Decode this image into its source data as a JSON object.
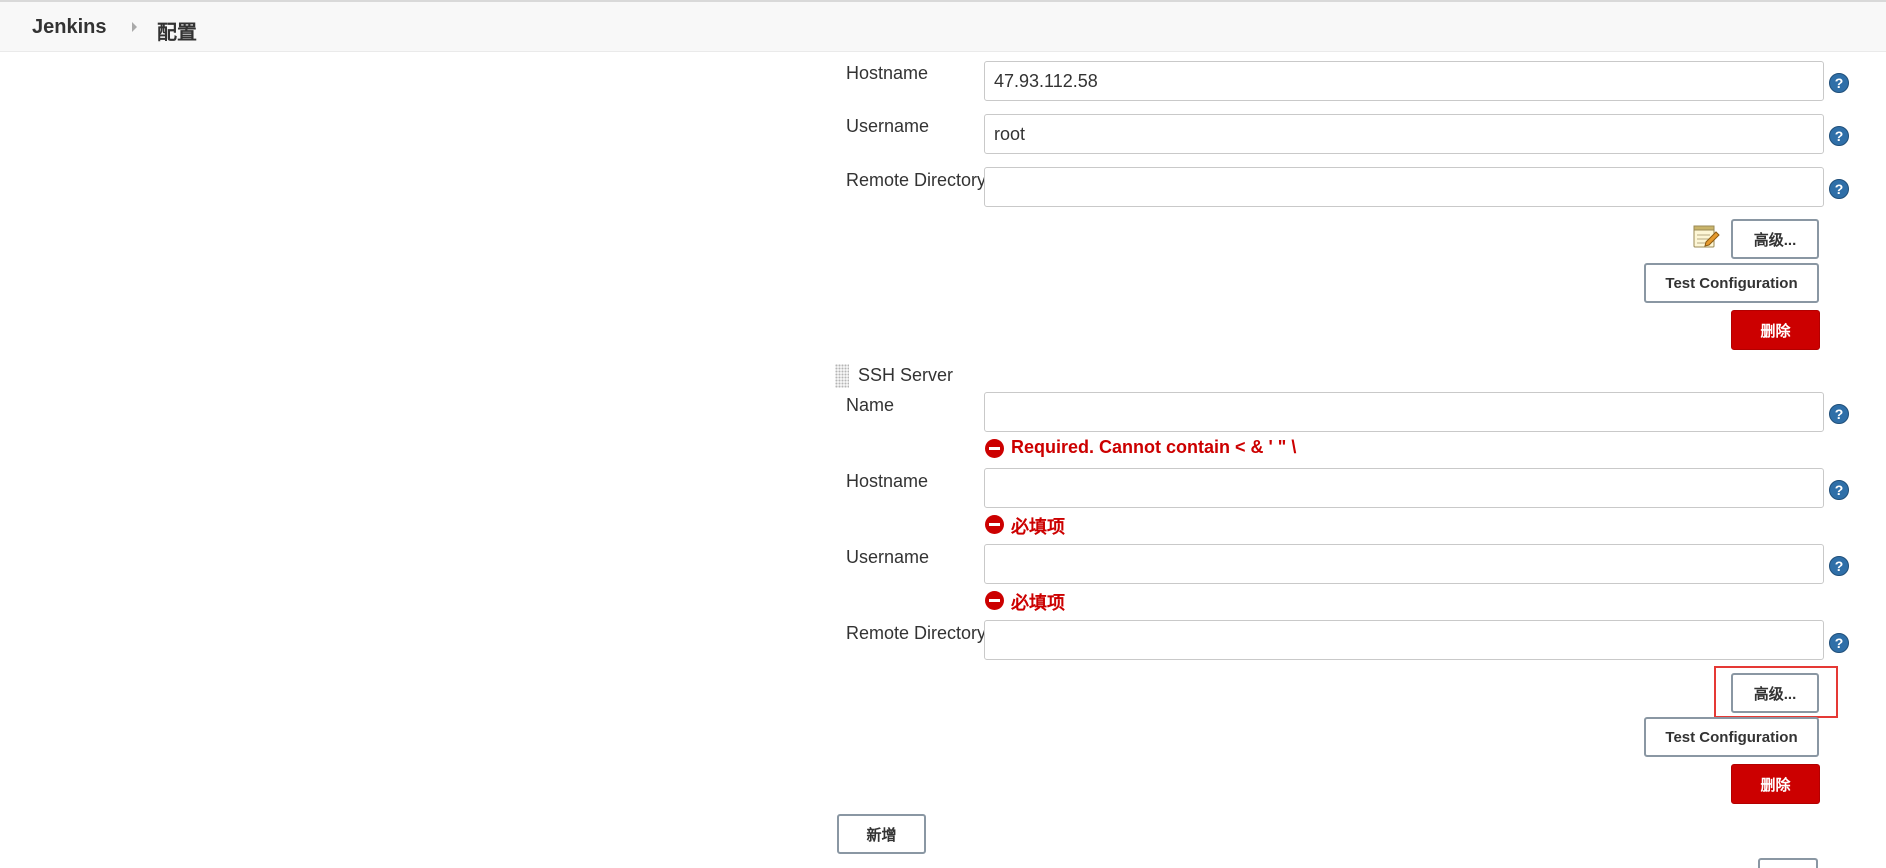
{
  "breadcrumb": {
    "root": "Jenkins",
    "page": "配置"
  },
  "server1": {
    "hostname_label": "Hostname",
    "hostname_value": "47.93.112.58",
    "username_label": "Username",
    "username_value": "root",
    "remote_dir_label": "Remote Directory",
    "remote_dir_value": "",
    "advanced_label": "高级...",
    "test_label": "Test Configuration",
    "delete_label": "删除"
  },
  "server2": {
    "section_title": "SSH Server",
    "name_label": "Name",
    "name_value": "",
    "name_error": "Required. Cannot contain < & ' \" \\",
    "hostname_label": "Hostname",
    "hostname_value": "",
    "hostname_error": "必填项",
    "username_label": "Username",
    "username_value": "",
    "username_error": "必填项",
    "remote_dir_label": "Remote Directory",
    "remote_dir_value": "",
    "advanced_label": "高级...",
    "test_label": "Test Configuration",
    "delete_label": "删除"
  },
  "add_label": "新增",
  "help_glyph": "?",
  "icons": {
    "help": "help-icon",
    "error": "error-icon",
    "notepad": "notepad-icon",
    "drag": "drag-handle-icon"
  },
  "colors": {
    "error_red": "#cc0000",
    "help_blue": "#2f6fa8",
    "button_border": "#8a97a3",
    "highlight": "#e53935"
  }
}
